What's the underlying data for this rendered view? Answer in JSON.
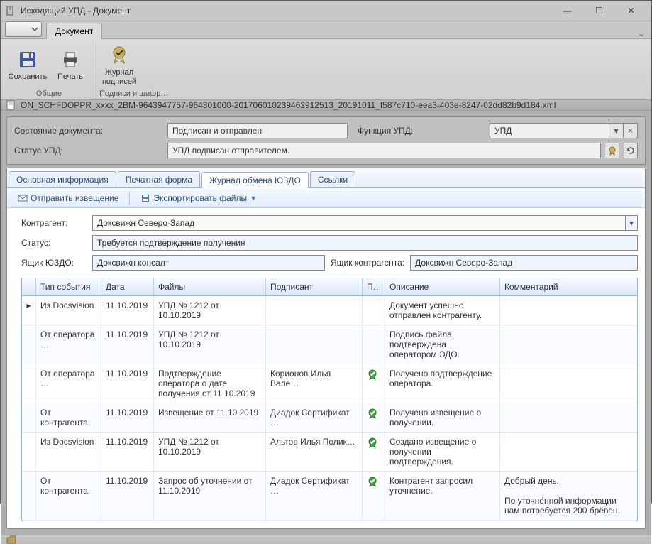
{
  "window": {
    "title": "Исходящий УПД - Документ"
  },
  "ribbon": {
    "tab": "Документ",
    "group_common": "Общие",
    "group_sign": "Подписи и шифр…",
    "save": "Сохранить",
    "print": "Печать",
    "journal": "Журнал\nподписей"
  },
  "pathbar": {
    "filename": "ON_SCHFDOPPR_xxxx_2BM-9643947757-964301000-201706010239462912513_20191011_f587c710-eea3-403e-8247-02dd82b9d184.xml"
  },
  "header": {
    "label_docstate": "Состояние документа:",
    "value_docstate": "Подписан и отправлен",
    "label_func": "Функция УПД:",
    "value_func": "УПД",
    "label_status": "Статус УПД:",
    "value_status": "УПД подписан отправителем."
  },
  "tabs": {
    "t1": "Основная информация",
    "t2": "Печатная форма",
    "t3": "Журнал обмена ЮЗДО",
    "t4": "Ссылки"
  },
  "toolbar2": {
    "notify": "Отправить извещение",
    "export": "Экспортировать файлы"
  },
  "journal": {
    "label_counter": "Контрагент:",
    "value_counter": "Доксвижн Северо-Запад",
    "label_status": "Статус:",
    "value_status": "Требуется подтверждение получения",
    "label_box": "Ящик ЮЗДО:",
    "value_box": "Доксвижн консалт",
    "label_cbox": "Ящик контрагента:",
    "value_cbox": "Доксвижн Северо-Запад"
  },
  "grid": {
    "cols": {
      "event": "Тип события",
      "date": "Дата",
      "files": "Файлы",
      "signer": "Подписант",
      "prov": "Пров…",
      "desc": "Описание",
      "comment": "Комментарий"
    },
    "rows": [
      {
        "ind": "▸",
        "event": "Из Docsvision",
        "date": "11.10.2019",
        "files": "УПД № 1212 от 10.10.2019",
        "signer": "",
        "prov": "",
        "desc": "Документ успешно отправлен контрагенту.",
        "comment": ""
      },
      {
        "ind": "",
        "event": "От оператора …",
        "date": "11.10.2019",
        "files": "УПД № 1212 от 10.10.2019",
        "signer": "",
        "prov": "",
        "desc": "Подпись файла подтверждена оператором ЭДО.",
        "comment": ""
      },
      {
        "ind": "",
        "event": "От оператора …",
        "date": "11.10.2019",
        "files": "Подтверждение оператора о дате получения от 11.10.2019",
        "signer": "Корионов Илья Вале…",
        "prov": "✔",
        "desc": "Получено подтверждение оператора.",
        "comment": ""
      },
      {
        "ind": "",
        "event": "От контрагента",
        "date": "11.10.2019",
        "files": "Извещение от 11.10.2019",
        "signer": "Диадок Сертификат …",
        "prov": "✔",
        "desc": "Получено извещение о получении.",
        "comment": ""
      },
      {
        "ind": "",
        "event": "Из Docsvision",
        "date": "11.10.2019",
        "files": "УПД № 1212 от 10.10.2019",
        "signer": "Альтов Илья Полик…",
        "prov": "✔",
        "desc": "Создано извещение о получении подтверждения.",
        "comment": ""
      },
      {
        "ind": "",
        "event": "От контрагента",
        "date": "11.10.2019",
        "files": "Запрос об уточнении от 11.10.2019",
        "signer": "Диадок Сертификат …",
        "prov": "✔",
        "desc": "Контрагент запросил уточнение.",
        "comment": "Добрый день.\n\nПо уточнённой информации нам потребуется 200 брёвен."
      }
    ]
  }
}
